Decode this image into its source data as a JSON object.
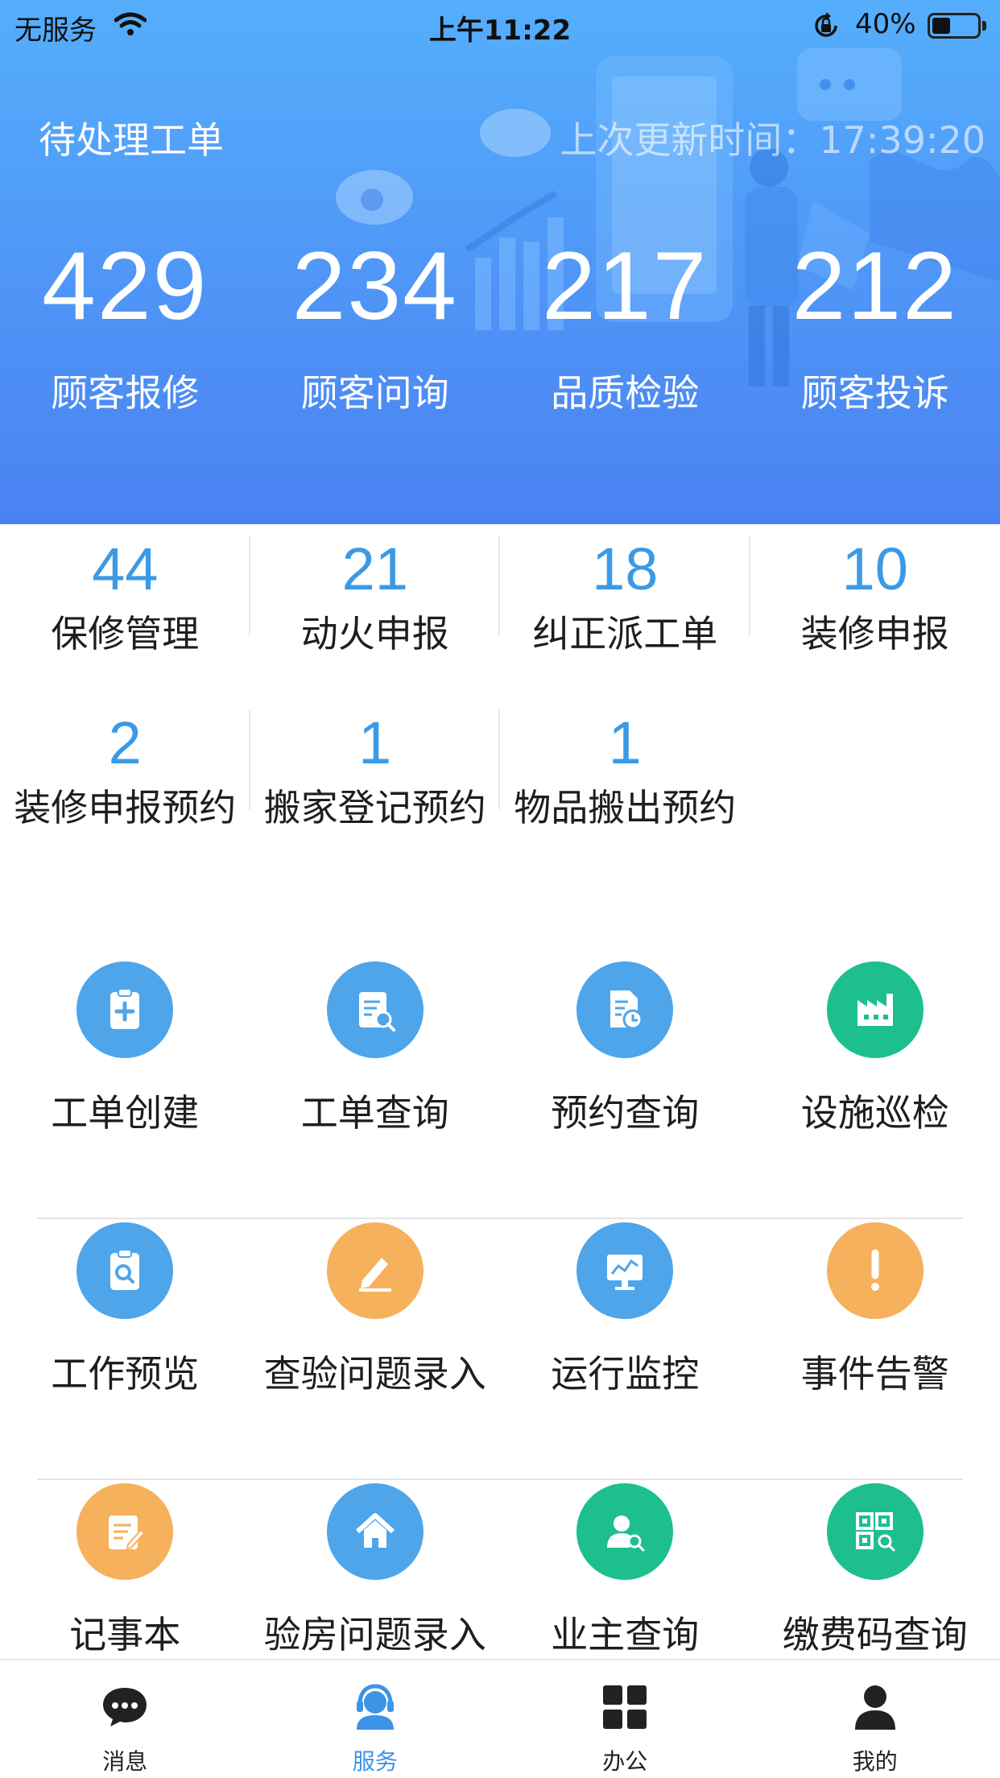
{
  "status_bar": {
    "carrier": "无服务",
    "time": "上午11:22",
    "battery": "40%",
    "battery_level": 0.4
  },
  "header": {
    "title": "待处理工单",
    "last_update": "上次更新时间：17:39:20",
    "stats": [
      {
        "value": "429",
        "label": "顾客报修"
      },
      {
        "value": "234",
        "label": "顾客问询"
      },
      {
        "value": "217",
        "label": "品质检验"
      },
      {
        "value": "212",
        "label": "顾客投诉"
      }
    ]
  },
  "pending": [
    {
      "value": "44",
      "label": "保修管理"
    },
    {
      "value": "21",
      "label": "动火申报"
    },
    {
      "value": "18",
      "label": "纠正派工单"
    },
    {
      "value": "10",
      "label": "装修申报"
    },
    {
      "value": "2",
      "label": "装修申报预约"
    },
    {
      "value": "1",
      "label": "搬家登记预约"
    },
    {
      "value": "1",
      "label": "物品搬出预约"
    }
  ],
  "services": [
    {
      "label": "工单创建",
      "icon": "clipboard-plus-icon",
      "color": "#4ea5ea"
    },
    {
      "label": "工单查询",
      "icon": "clipboard-search-icon",
      "color": "#4ea5ea"
    },
    {
      "label": "预约查询",
      "icon": "document-clock-icon",
      "color": "#4ea5ea"
    },
    {
      "label": "设施巡检",
      "icon": "factory-icon",
      "color": "#1dbf8e"
    },
    {
      "label": "工作预览",
      "icon": "clipboard-magnifier-icon",
      "color": "#4ea5ea"
    },
    {
      "label": "查验问题录入",
      "icon": "pencil-icon",
      "color": "#f6b15c"
    },
    {
      "label": "运行监控",
      "icon": "monitor-chart-icon",
      "color": "#4ea5ea"
    },
    {
      "label": "事件告警",
      "icon": "exclamation-icon",
      "color": "#f6b15c"
    },
    {
      "label": "记事本",
      "icon": "notepad-icon",
      "color": "#f6b15c"
    },
    {
      "label": "验房问题录入",
      "icon": "house-icon",
      "color": "#4ea5ea"
    },
    {
      "label": "业主查询",
      "icon": "user-search-icon",
      "color": "#1dbf8e"
    },
    {
      "label": "缴费码查询",
      "icon": "qrcode-search-icon",
      "color": "#1dbf8e"
    }
  ],
  "tabs": [
    {
      "label": "消息",
      "icon": "chat-bubble-icon",
      "active": false
    },
    {
      "label": "服务",
      "icon": "headset-agent-icon",
      "active": true
    },
    {
      "label": "办公",
      "icon": "grid-icon",
      "active": false
    },
    {
      "label": "我的",
      "icon": "person-icon",
      "active": false
    }
  ],
  "colors": {
    "accent": "#3b9ae6",
    "banner_top": "#55aefc",
    "banner_bottom": "#4a82f2",
    "green": "#1dbf8e",
    "orange": "#f6b15c"
  }
}
